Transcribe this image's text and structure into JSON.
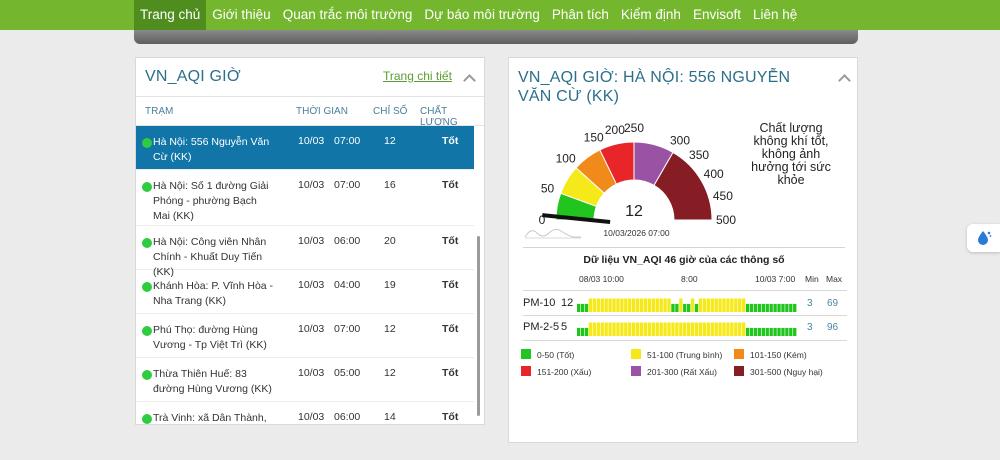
{
  "nav": {
    "items": [
      {
        "label": "Trang chủ",
        "active": true
      },
      {
        "label": "Giới thiệu"
      },
      {
        "label": "Quan trắc môi trường"
      },
      {
        "label": "Dự báo môi trường"
      },
      {
        "label": "Phân tích"
      },
      {
        "label": "Kiểm định"
      },
      {
        "label": "Envisoft"
      },
      {
        "label": "Liên hệ"
      }
    ]
  },
  "left_panel": {
    "title": "VN_AQI GIỜ",
    "detail_link": "Trang chi tiết",
    "columns": {
      "station": "TRẠM",
      "time": "THỜI GIAN",
      "index": "CHỈ SỐ",
      "quality": "CHẤT LƯỢNG"
    },
    "rows": [
      {
        "station": "Hà Nội: 556 Nguyễn Văn Cừ (KK)",
        "date": "10/03",
        "hour": "07:00",
        "index": "12",
        "quality": "Tốt",
        "selected": true
      },
      {
        "station": "Hà Nội: Số 1 đường Giải Phóng - phường Bạch Mai (KK)",
        "date": "10/03",
        "hour": "07:00",
        "index": "16",
        "quality": "Tốt"
      },
      {
        "station": "Hà Nội: Công viên Nhân Chính - Khuất Duy Tiến (KK)",
        "date": "10/03",
        "hour": "06:00",
        "index": "20",
        "quality": "Tốt"
      },
      {
        "station": "Khánh Hòa: P. Vĩnh Hòa - Nha Trang (KK)",
        "date": "10/03",
        "hour": "04:00",
        "index": "19",
        "quality": "Tốt"
      },
      {
        "station": "Phú Thọ: đường Hùng Vương - Tp Việt Trì (KK)",
        "date": "10/03",
        "hour": "07:00",
        "index": "12",
        "quality": "Tốt"
      },
      {
        "station": "Thừa Thiên Huế: 83 đường Hùng Vương (KK)",
        "date": "10/03",
        "hour": "05:00",
        "index": "12",
        "quality": "Tốt"
      },
      {
        "station": "Trà Vinh: xã Dân Thành, TX",
        "date": "10/03",
        "hour": "06:00",
        "index": "14",
        "quality": "Tốt"
      }
    ]
  },
  "right_panel": {
    "title": "VN_AQI GIỜ: HÀ NỘI: 556 NGUYỄN VĂN CỪ (KK)",
    "gauge": {
      "value": "12",
      "timestamp": "10/03/2026 07:00",
      "quality_note": "Chất lượng không khí tốt, không ảnh hưởng tới sức khỏe",
      "ticks": [
        "0",
        "50",
        "100",
        "150",
        "200",
        "250",
        "300",
        "350",
        "400",
        "450",
        "500"
      ],
      "reading": 12,
      "max": 500
    },
    "history": {
      "title": "Dữ liệu VN_AQI 46 giờ của các thông số",
      "axis_labels": [
        "08/03 10:00",
        "8:00",
        "10/03 7:00"
      ],
      "min_label": "Min",
      "max_label": "Max",
      "params": [
        {
          "name": "PM-10",
          "current": "12",
          "min": "3",
          "max": "69",
          "pattern": "GGGYYYYYYYYYYYYYYYYYYYYYGGYGGYGYYYYYYYYYYYYGGGGGGGGGGGGG"
        },
        {
          "name": "PM-2-5",
          "current": "5",
          "min": "3",
          "max": "96",
          "pattern": "GGGYYYYYYYYYYYYYYYYYYYYYYYYYYYYYYYYYYYYYYYYGGGGGGGGGGGGG"
        }
      ]
    },
    "legend": [
      {
        "range": "0-50 (Tốt)",
        "color": "#22c51f"
      },
      {
        "range": "51-100 (Trung bình)",
        "color": "#f6e91a"
      },
      {
        "range": "101-150 (Kém)",
        "color": "#f08a1b"
      },
      {
        "range": "151-200 (Xấu)",
        "color": "#e8262a"
      },
      {
        "range": "201-300 (Rất Xấu)",
        "color": "#9a53a4"
      },
      {
        "range": "301-500 (Nguy hại)",
        "color": "#861c24"
      }
    ]
  },
  "colors": {
    "nav": "#74b72e",
    "nav_active": "#4f8d1f",
    "selected_row": "#1175a8",
    "title": "#2c6f8a"
  }
}
